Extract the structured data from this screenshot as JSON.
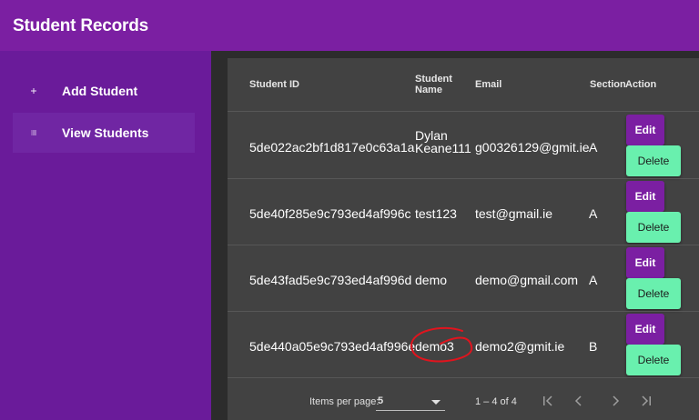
{
  "app": {
    "title": "Student Records"
  },
  "sidebar": {
    "items": [
      {
        "label": "Add Student",
        "icon": "plus-icon"
      },
      {
        "label": "View Students",
        "icon": "list-icon",
        "active": true
      }
    ]
  },
  "table": {
    "columns": [
      "Student ID",
      "Student Name",
      "Email",
      "Section",
      "Action"
    ],
    "rows": [
      {
        "id": "5de022ac2bf1d817e0c63a1a",
        "name": "Dylan Keane111",
        "email": "g00326129@gmit.ie",
        "section": "A"
      },
      {
        "id": "5de40f285e9c793ed4af996c",
        "name": "test123",
        "email": "test@gmail.ie",
        "section": "A"
      },
      {
        "id": "5de43fad5e9c793ed4af996d",
        "name": "demo",
        "email": "demo@gmail.com",
        "section": "A"
      },
      {
        "id": "5de440a05e9c793ed4af996e",
        "name": "demo3",
        "email": "demo2@gmit.ie",
        "section": "B"
      }
    ],
    "edit_label": "Edit",
    "delete_label": "Delete"
  },
  "paginator": {
    "items_per_page_label": "Items per page:",
    "page_size": "5",
    "range_label": "1 – 4 of 4"
  },
  "colors": {
    "toolbar": "#7b1fa2",
    "sidebar": "#6a1b9a",
    "card": "#424242",
    "edit_button": "#7b1fa2",
    "delete_button": "#69f0ae",
    "annotation": "#e0141e"
  }
}
